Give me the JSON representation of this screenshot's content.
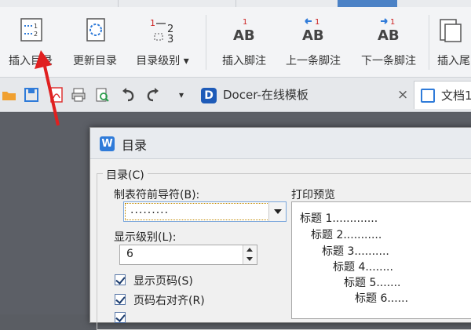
{
  "ribbon": {
    "buttons": [
      {
        "label": "插入目录"
      },
      {
        "label": "更新目录"
      },
      {
        "label": "目录级别 ▾"
      },
      {
        "label": "插入脚注"
      },
      {
        "label": "上一条脚注"
      },
      {
        "label": "下一条脚注"
      },
      {
        "label": "插入尾"
      }
    ],
    "accent_tab_color": "#4c82c6"
  },
  "quickbar": {
    "tabs": [
      {
        "label": "Docer-在线模板"
      },
      {
        "label": "文档1"
      }
    ],
    "close_glyph": "×",
    "more_glyph": "▾"
  },
  "dialog": {
    "title": "目录",
    "icon_letter": "W",
    "group_label": "目录(C)",
    "leader_label": "制表符前导符(B):",
    "leader_value": ".........",
    "levels_label": "显示级别(L):",
    "levels_value": "6",
    "show_page_numbers": {
      "label": "显示页码(S)",
      "checked": true
    },
    "right_align": {
      "label": "页码右对齐(R)",
      "checked": true
    },
    "preview_label": "打印预览",
    "preview_lines": [
      "标题 1.............",
      "标题 2...........",
      "标题 3..........",
      "标题 4........",
      "标题 5.......",
      "标题 6......"
    ]
  },
  "annotation": {
    "color": "#e02020"
  }
}
